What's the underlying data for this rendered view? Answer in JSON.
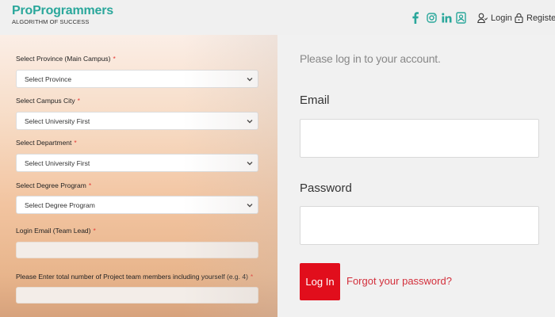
{
  "header": {
    "logo_title": "ProProgrammers",
    "logo_tagline": "ALGORITHM OF SUCCESS",
    "social_icons": [
      "facebook-icon",
      "instagram-icon",
      "linkedin-icon",
      "contact-icon"
    ],
    "login_label": "Login",
    "register_label": "Register",
    "brand_color": "#2aa79b"
  },
  "form": {
    "province_label": "Select Province (Main Campus)",
    "province_value": "Select Province",
    "city_label": "Select Campus City",
    "city_value": "Select University First",
    "department_label": "Select Department",
    "department_value": "Select University First",
    "degree_label": "Select Degree Program",
    "degree_value": "Select Degree Program",
    "email_label": "Login Email (Team Lead)",
    "email_value": "",
    "members_label": "Please Enter total number of Project team members including yourself (e.g. 4)",
    "members_value": "",
    "required_marker": "*"
  },
  "login": {
    "heading": "Please log in to your account.",
    "email_label": "Email",
    "email_value": "",
    "password_label": "Password",
    "password_value": "",
    "button_label": "Log In",
    "forgot_label": "Forgot your password?",
    "accent_color": "#e10e1c"
  }
}
